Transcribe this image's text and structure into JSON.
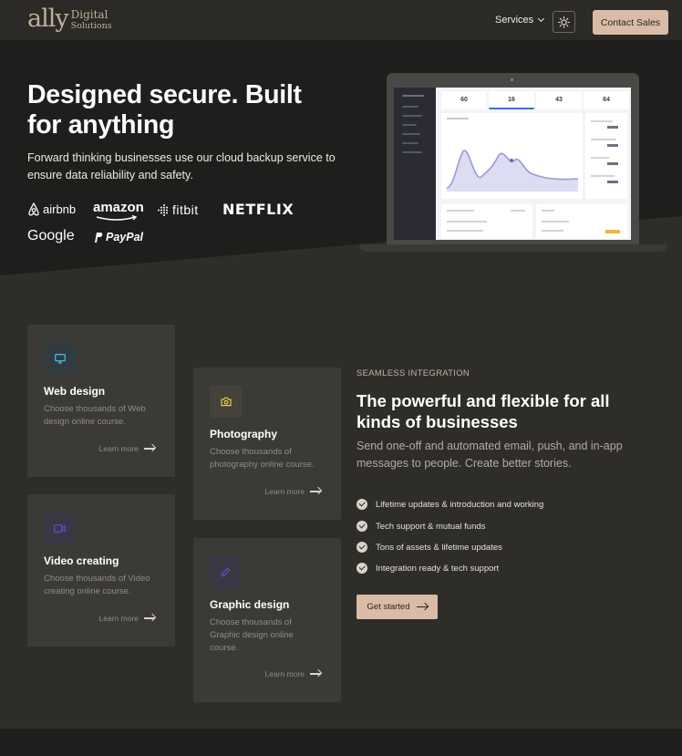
{
  "header": {
    "logo_mark": "ally",
    "logo_line1": "Digital",
    "logo_line2": "Solutions",
    "nav_services": "Services",
    "contact_label": "Contact Sales"
  },
  "hero": {
    "title": "Designed secure. Built for anything",
    "subtitle": "Forward thinking businesses use our cloud backup service to ensure data reliability and safety.",
    "brands": [
      "airbnb",
      "amazon",
      "fitbit",
      "NETFLIX",
      "Google",
      "PayPal"
    ]
  },
  "dashboard": {
    "kpis": [
      "60",
      "16",
      "43",
      "64"
    ]
  },
  "cards": [
    {
      "title": "Web design",
      "desc": "Choose thousands of Web design online course.",
      "link": "Learn more",
      "icon": "monitor-icon",
      "color": "#3fb6e0"
    },
    {
      "title": "Photography",
      "desc": "Choose thousands of photography online course.",
      "link": "Learn more",
      "icon": "camera-icon",
      "color": "#e8c94a"
    },
    {
      "title": "Video creating",
      "desc": "Choose thousands of Video creating online course.",
      "link": "Learn more",
      "icon": "video-icon",
      "color": "#5b4fc4"
    },
    {
      "title": "Graphic design",
      "desc": "Choose thousands of Graphic design online course.",
      "link": "Learn more",
      "icon": "pen-icon",
      "color": "#6a4fc4"
    }
  ],
  "integration": {
    "eyebrow": "SEAMLESS INTEGRATION",
    "title": "The powerful and flexible  for all kinds of businesses",
    "subtitle": "Send one-off and automated email, push, and in-app messages to people. Create better stories.",
    "checks": [
      "Lifetime updates & introduction and working",
      "Tech support & mutual funds",
      "Tons of assets & lifetime updates",
      "Integration ready & tech support"
    ],
    "cta": "Get started"
  },
  "colors": {
    "accent": "#d9bba7",
    "hero_bg": "#1f1e1c",
    "page_bg": "#2f2d28"
  }
}
